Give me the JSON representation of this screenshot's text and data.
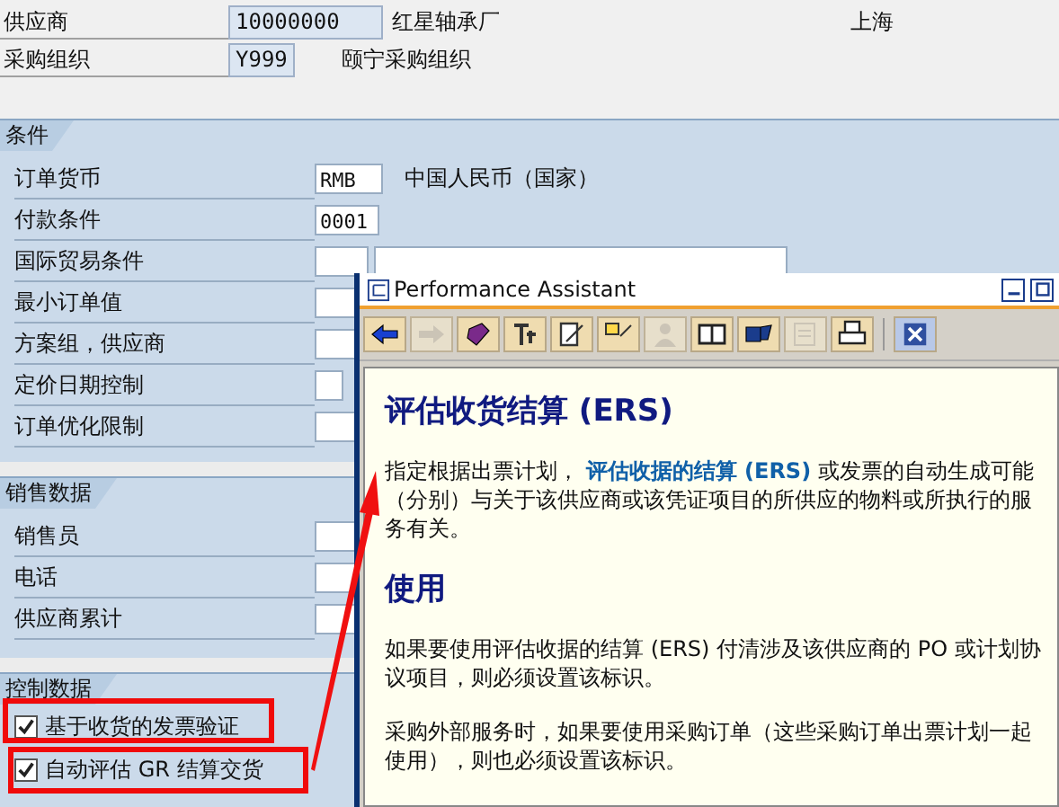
{
  "header": {
    "rows": [
      {
        "label": "供应商",
        "value": "10000000",
        "description": "红星轴承厂",
        "extra": "上海"
      },
      {
        "label": "采购组织",
        "value": "Y999",
        "description": "颐宁采购组织"
      }
    ]
  },
  "sections": [
    {
      "title": "条件",
      "rows": [
        {
          "label": "订单货币",
          "kind": "single",
          "value": "RMB",
          "description": "中国人民币（国家）"
        },
        {
          "label": "付款条件",
          "kind": "short",
          "value": "0001"
        },
        {
          "label": "国际贸易条件",
          "kind": "double"
        },
        {
          "label": "最小订单值",
          "kind": "single"
        },
        {
          "label": "方案组，供应商",
          "kind": "single"
        },
        {
          "label": "定价日期控制",
          "kind": "tiny"
        },
        {
          "label": "订单优化限制",
          "kind": "single"
        }
      ]
    },
    {
      "title": "销售数据",
      "rows": [
        {
          "label": "销售员",
          "kind": "single"
        },
        {
          "label": "电话",
          "kind": "single"
        },
        {
          "label": "供应商累计",
          "kind": "single"
        }
      ]
    },
    {
      "title": "控制数据",
      "rows": [
        {
          "label": "基于收货的发票验证",
          "kind": "checkbox",
          "checked": true
        },
        {
          "label": "自动评估 GR 结算交货",
          "kind": "checkbox",
          "checked": true
        }
      ]
    }
  ],
  "assistant": {
    "title": "Performance Assistant",
    "toolbar": [
      {
        "disabled": false
      },
      {
        "disabled": true
      },
      {
        "disabled": false
      },
      {
        "disabled": false
      },
      {
        "disabled": false
      },
      {
        "disabled": false
      },
      {
        "disabled": true
      },
      {
        "disabled": false
      },
      {
        "disabled": false
      },
      {
        "disabled": true
      },
      {
        "disabled": false
      }
    ],
    "content": [
      {
        "kind": "heading",
        "text": "评估收货结算  (ERS)"
      },
      {
        "kind": "paragraph",
        "text": "指定根据出票计划， **评估收据的结算 (ERS)** 或发票的自动生成可能（分别）与关于该供应商或该凭证项目的所供应的物料或所执行的服务有关。"
      },
      {
        "kind": "heading",
        "text": "使用"
      },
      {
        "kind": "paragraph",
        "text": "如果要使用评估收据的结算 (ERS) 付清涉及该供应商的 PO 或计划协议项目，则必须设置该标识。"
      },
      {
        "kind": "paragraph",
        "text": "采购外部服务时，如果要使用采购订单（这些采购订单出票计划一起使用），则也必须设置该标识。"
      }
    ]
  }
}
